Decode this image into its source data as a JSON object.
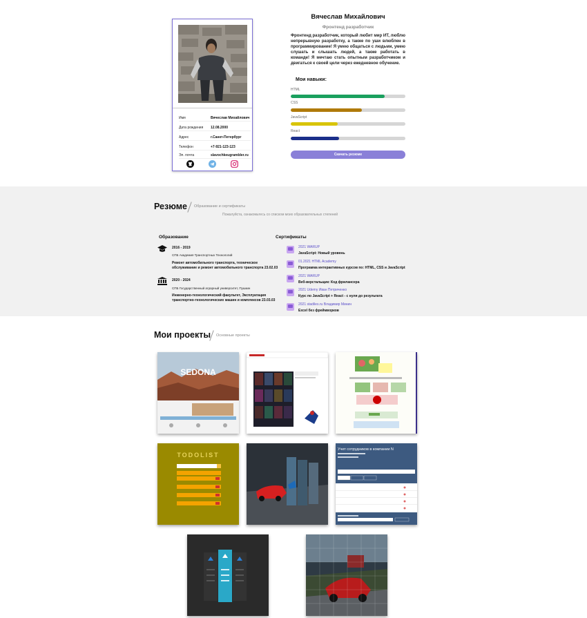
{
  "profile": {
    "name": "Вячеслав Михайлович",
    "role": "Фронтенд разработчик",
    "about": "Фронтенд разработчик, который любит мир ИТ, люблю непрерывную разработку, а также по уши влюблен в программирование! Я умею общаться с людьми, умею слушать и слышать людей, а также работать в команде! Я мечтаю стать опытным разработчиком и двигаться к своей цели через ежедневное обучение.",
    "info": [
      {
        "key": "Имя",
        "value": "Вячеслав Михайлович"
      },
      {
        "key": "Дата рождения",
        "value": "12.08.2000"
      },
      {
        "key": "Адрес",
        "value": "г.Санкт-Петербург"
      },
      {
        "key": "Телефон",
        "value": "+7-921-123-123"
      },
      {
        "key": "Эл. почта",
        "value": "slavochkeugrambler.ru"
      }
    ],
    "socials": [
      "github-icon",
      "telegram-icon",
      "instagram-icon"
    ]
  },
  "skills": {
    "title": "Мои навыки:",
    "items": [
      {
        "label": "HTML",
        "value": 0.82,
        "color": "#1aa05e"
      },
      {
        "label": "CSS",
        "value": 0.62,
        "color": "#b07a0a"
      },
      {
        "label": "JavaScript",
        "value": 0.41,
        "color": "#d8c40a"
      },
      {
        "label": "React",
        "value": 0.42,
        "color": "#1b2f8a"
      }
    ],
    "download_label": "Скачать резюме"
  },
  "resume": {
    "title": "Резюме",
    "subtitle": "Образование и сертификаты",
    "hint": "Пожалуйста, ознакомьтесь со списком моих образовательных степеней",
    "education_title": "Образование",
    "education": [
      {
        "years": "2016 - 2019",
        "institution": "СПБ Академия Транспортных Технологий",
        "description": "Ремонт автомобильного транспорта, техническое обслуживание и ремонт автомобильного транспорта 23.02.03"
      },
      {
        "years": "2020 - 2024",
        "institution": "СПБ Государственный аграрный университет, Пушкин",
        "description": "Инженерно-технологический факультет, Эксплуатация транспортно-технологических машин и комплексов 23.03.03"
      }
    ],
    "certificates_title": "Сертификаты",
    "certificates": [
      {
        "date": "2021 WARUP",
        "name": "JavaScript: Новый уровень"
      },
      {
        "date": "01.2021 HTML Academy",
        "name": "Программа интерактивных курсов по: HTML, CSS и JavaScript"
      },
      {
        "date": "2021 WARUP",
        "name": "Веб-верстальщик: Код фрилансера"
      },
      {
        "date": "2021 Udemy Иван Петриченко",
        "name": "Курс по JavaScript + React - с нуля до результата"
      },
      {
        "date": "2021 stadiles.ru Владимир Минин",
        "name": "Excel без фреймворков"
      }
    ]
  },
  "projects": {
    "title": "Мои проекты",
    "subtitle": "Основные проекты",
    "items": [
      {
        "name": "project-sedona",
        "text": "SEDONA"
      },
      {
        "name": "project-movies",
        "text": ""
      },
      {
        "name": "project-food",
        "text": ""
      },
      {
        "name": "project-todolist",
        "text": "TODOLIST"
      },
      {
        "name": "project-cars-slider",
        "text": ""
      },
      {
        "name": "project-employees",
        "text": "Учет сотрудников в компании N"
      },
      {
        "name": "project-pricing",
        "text": ""
      },
      {
        "name": "project-car-puzzle",
        "text": ""
      }
    ]
  }
}
